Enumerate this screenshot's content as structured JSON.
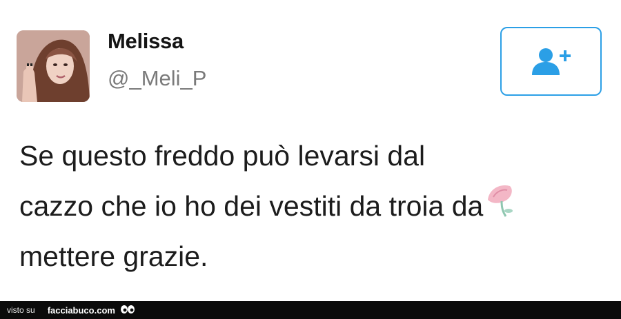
{
  "tweet": {
    "user": {
      "display_name": "Melissa",
      "handle": "@_Meli_P",
      "avatar_icon": "profile-photo"
    },
    "follow_button": {
      "icon": "follow-user-icon",
      "accent_color": "#2b9fe6"
    },
    "text_lines": [
      "Se questo freddo può levarsi dal",
      "cazzo che io ho dei vestiti da troia da",
      "mettere grazie."
    ],
    "sticker_icon": "flower-sticker-icon"
  },
  "watermark": {
    "prefix": "visto su",
    "brand": "facciabuco.com",
    "icon": "eyes-logo-icon"
  }
}
